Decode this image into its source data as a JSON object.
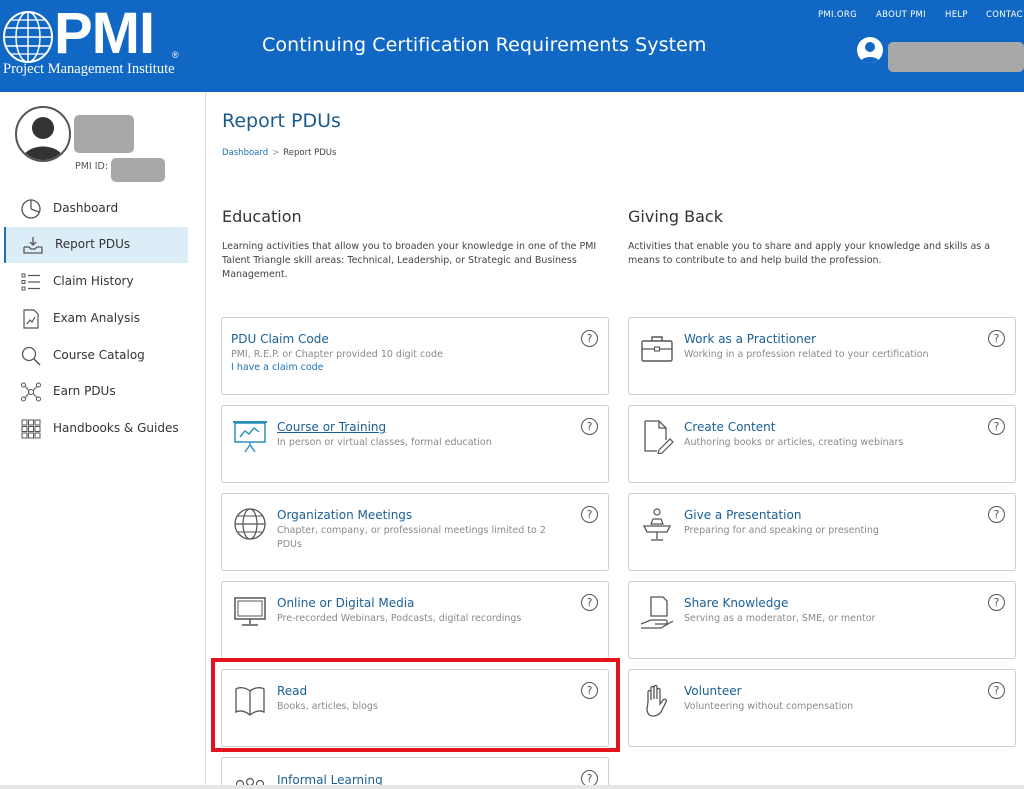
{
  "header": {
    "logo_text": "PMI",
    "logo_reg": "®",
    "logo_subtitle": "Project Management Institute",
    "app_title": "Continuing Certification Requirements System",
    "top_nav": [
      "PMI.ORG",
      "ABOUT PMI",
      "HELP",
      "CONTAC"
    ]
  },
  "sidebar": {
    "pmi_id_label": "PMI ID:",
    "items": [
      {
        "label": "Dashboard",
        "icon": "pie-chart-icon",
        "active": false
      },
      {
        "label": "Report PDUs",
        "icon": "inbox-download-icon",
        "active": true
      },
      {
        "label": "Claim History",
        "icon": "list-icon",
        "active": false
      },
      {
        "label": "Exam Analysis",
        "icon": "document-chart-icon",
        "active": false
      },
      {
        "label": "Course Catalog",
        "icon": "magnifier-icon",
        "active": false
      },
      {
        "label": "Earn PDUs",
        "icon": "network-icon",
        "active": false
      },
      {
        "label": "Handbooks & Guides",
        "icon": "grid-icon",
        "active": false
      }
    ]
  },
  "main": {
    "title": "Report PDUs",
    "breadcrumb": {
      "home": "Dashboard",
      "separator": ">",
      "current": "Report PDUs"
    },
    "help_glyph": "?",
    "education": {
      "title": "Education",
      "description": "Learning activities that allow you to broaden your knowledge in one of the PMI Talent Triangle skill areas: Technical, Leadership, or Strategic and Business Management.",
      "cards": [
        {
          "title": "PDU Claim Code",
          "desc": "PMI, R.E.P. or Chapter provided 10 digit code",
          "link": "I have a claim code",
          "icon": ""
        },
        {
          "title": "Course or Training",
          "desc": "In person or virtual classes, formal education",
          "icon": "presentation-board-icon"
        },
        {
          "title": "Organization Meetings",
          "desc": "Chapter, company, or professional meetings limited to 2 PDUs",
          "icon": "globe-icon"
        },
        {
          "title": "Online or Digital Media",
          "desc": "Pre-recorded Webinars, Podcasts, digital recordings",
          "icon": "monitor-icon"
        },
        {
          "title": "Read",
          "desc": "Books, articles, blogs",
          "icon": "open-book-icon"
        },
        {
          "title": "Informal Learning",
          "desc": "",
          "icon": "people-group-icon"
        }
      ]
    },
    "giving_back": {
      "title": "Giving Back",
      "description": "Activities that enable you to share and apply your knowledge and skills as a means to contribute to and help build the profession.",
      "cards": [
        {
          "title": "Work as a Practitioner",
          "desc": "Working in a profession related to your certification",
          "icon": "briefcase-icon"
        },
        {
          "title": "Create Content",
          "desc": "Authoring books or articles, creating webinars",
          "icon": "document-pen-icon"
        },
        {
          "title": "Give a Presentation",
          "desc": "Preparing for and speaking or presenting",
          "icon": "podium-icon"
        },
        {
          "title": "Share Knowledge",
          "desc": "Serving as a moderator, SME, or mentor",
          "icon": "hand-document-icon"
        },
        {
          "title": "Volunteer",
          "desc": "Volunteering without compensation",
          "icon": "raised-hand-icon"
        }
      ]
    }
  },
  "colors": {
    "header_bg": "#1167c4",
    "link": "#1a5f96",
    "highlight": "#e3141c",
    "active_nav_bg": "#dcedf7"
  }
}
